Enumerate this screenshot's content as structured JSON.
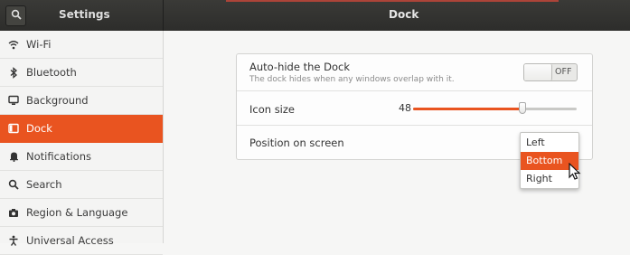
{
  "header": {
    "left_title": "Settings",
    "title": "Dock",
    "search_icon": "search-icon"
  },
  "sidebar": {
    "items": [
      {
        "label": "Wi-Fi",
        "icon": "wifi-icon",
        "active": false
      },
      {
        "label": "Bluetooth",
        "icon": "bluetooth-icon",
        "active": false
      },
      {
        "label": "Background",
        "icon": "monitor-icon",
        "active": false
      },
      {
        "label": "Dock",
        "icon": "dock-icon",
        "active": true
      },
      {
        "label": "Notifications",
        "icon": "bell-icon",
        "active": false
      },
      {
        "label": "Search",
        "icon": "search-icon",
        "active": false
      },
      {
        "label": "Region & Language",
        "icon": "camera-icon",
        "active": false
      },
      {
        "label": "Universal Access",
        "icon": "accessibility-icon",
        "active": false
      }
    ]
  },
  "dock": {
    "autohide": {
      "title": "Auto-hide the Dock",
      "subtitle": "The dock hides when any windows overlap with it.",
      "switch_state": "OFF"
    },
    "icon_size": {
      "label": "Icon size",
      "value": "48",
      "slider_fraction": 0.67
    },
    "position": {
      "label": "Position on screen",
      "options": [
        "Left",
        "Bottom",
        "Right"
      ],
      "selected": "Bottom"
    }
  },
  "colors": {
    "accent": "#e95420",
    "header_bg": "#333331",
    "sidebar_bg": "#f4f4f3"
  }
}
